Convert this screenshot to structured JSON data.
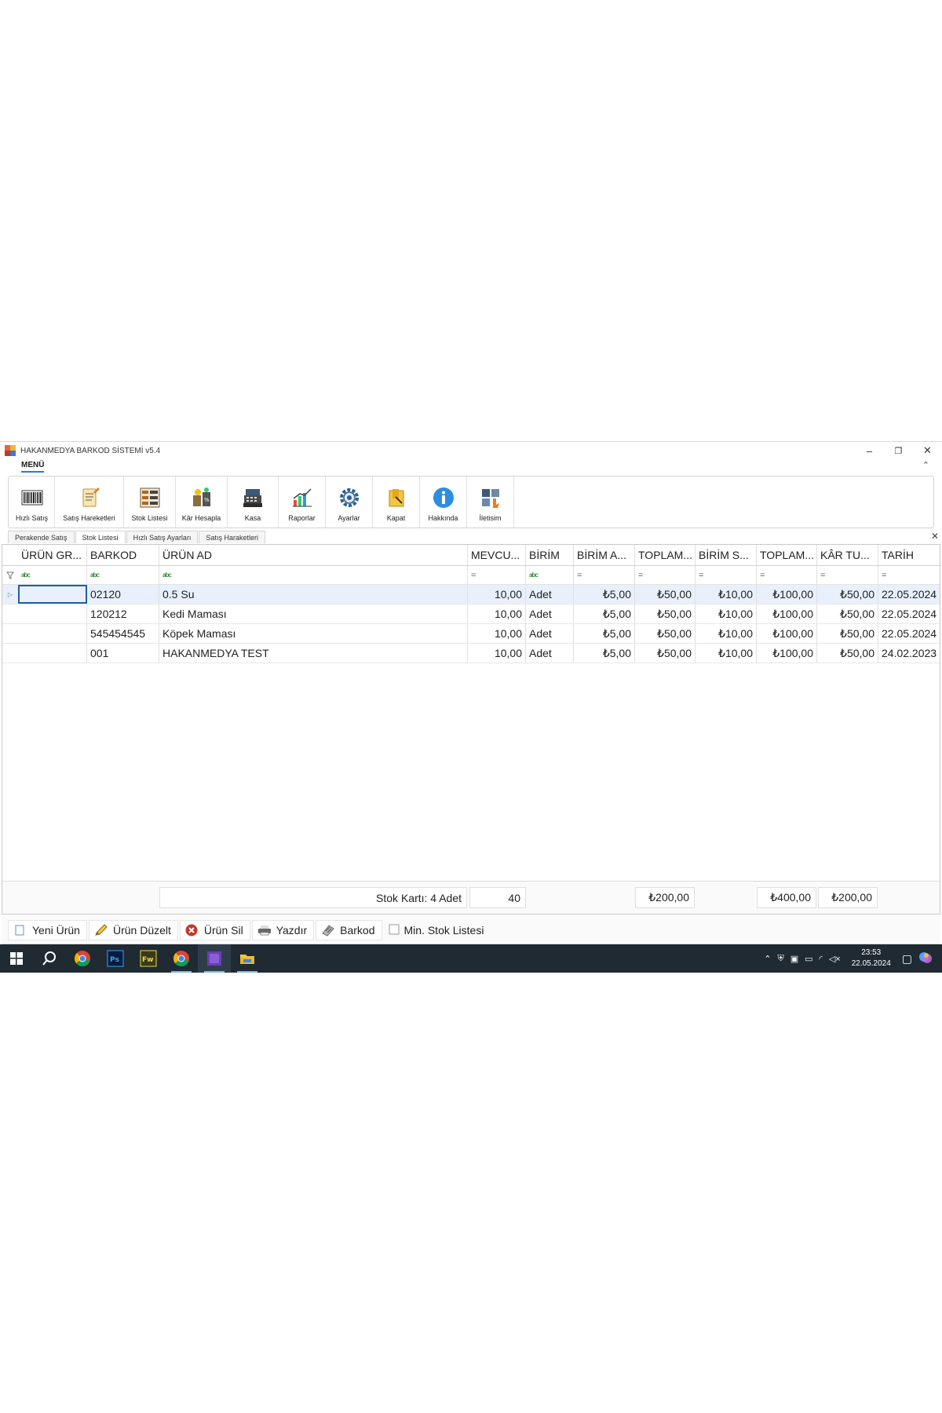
{
  "window": {
    "title": "HAKANMEDYA BARKOD SİSTEMİ v5.4",
    "minimize": "–",
    "restore": "❐",
    "close": "✕"
  },
  "menu": {
    "tab_label": "MENÜ",
    "collapse": "⌃"
  },
  "ribbon": {
    "buttons": [
      {
        "label": "Hızlı Satış",
        "icon": "barcode-icon"
      },
      {
        "label": "Satış Hareketleri",
        "icon": "notepad-icon"
      },
      {
        "label": "Stok Listesi",
        "icon": "stock-list-icon"
      },
      {
        "label": "Kâr Hesapla",
        "icon": "profit-calculator-icon"
      },
      {
        "label": "Kasa",
        "icon": "cash-register-icon"
      },
      {
        "label": "Raporlar",
        "icon": "chart-icon"
      },
      {
        "label": "Ayarlar",
        "icon": "gear-icon"
      },
      {
        "label": "Kapat",
        "icon": "exit-icon"
      },
      {
        "label": "Hakkında",
        "icon": "info-icon"
      },
      {
        "label": "İletisim",
        "icon": "contact-icon"
      }
    ]
  },
  "doc_tabs": [
    {
      "label": "Perakende Satış",
      "active": false
    },
    {
      "label": "Stok Listesi",
      "active": true
    },
    {
      "label": "Hızlı Satış Ayarları",
      "active": false
    },
    {
      "label": "Satış Haraketleri",
      "active": false
    }
  ],
  "doc_close": "✕",
  "grid": {
    "columns": [
      "ÜRÜN GR...",
      "BARKOD",
      "ÜRÜN AD",
      "MEVCU...",
      "BİRİM",
      "BİRİM A...",
      "TOPLAM...",
      "BİRİM S...",
      "TOPLAM...",
      "KÂR TU...",
      "TARİH"
    ],
    "filter_row": [
      "abc",
      "abc",
      "abc",
      "=",
      "abc",
      "=",
      "=",
      "=",
      "=",
      "=",
      "="
    ],
    "rows": [
      [
        "",
        "02120",
        "0.5 Su",
        "10,00",
        "Adet",
        "₺5,00",
        "₺50,00",
        "₺10,00",
        "₺100,00",
        "₺50,00",
        "22.05.2024"
      ],
      [
        "",
        "120212",
        "Kedi Maması",
        "10,00",
        "Adet",
        "₺5,00",
        "₺50,00",
        "₺10,00",
        "₺100,00",
        "₺50,00",
        "22.05.2024"
      ],
      [
        "",
        "545454545",
        "Köpek Maması",
        "10,00",
        "Adet",
        "₺5,00",
        "₺50,00",
        "₺10,00",
        "₺100,00",
        "₺50,00",
        "22.05.2024"
      ],
      [
        "",
        "001",
        "HAKANMEDYA TEST",
        "10,00",
        "Adet",
        "₺5,00",
        "₺50,00",
        "₺10,00",
        "₺100,00",
        "₺50,00",
        "24.02.2023"
      ]
    ],
    "totals": {
      "stok_karti": "Stok Kartı: 4 Adet",
      "mevcut": "40",
      "toplam_alis": "₺200,00",
      "toplam_satis": "₺400,00",
      "kar": "₺200,00"
    }
  },
  "bottom_toolbar": [
    {
      "label": "Yeni Ürün",
      "icon": "new-icon"
    },
    {
      "label": "Ürün Düzelt",
      "icon": "pencil-icon"
    },
    {
      "label": "Ürün Sil",
      "icon": "delete-icon"
    },
    {
      "label": "Yazdır",
      "icon": "printer-icon"
    },
    {
      "label": "Barkod",
      "icon": "barcode-label-icon"
    },
    {
      "label": "Min. Stok Listesi",
      "icon": "checkbox-icon"
    }
  ],
  "taskbar": {
    "clock_time": "23:53",
    "clock_date": "22.05.2024"
  },
  "colors": {
    "accent": "#2a7bd4",
    "selected_row": "#e8f1fb",
    "taskbar": "#1f2a33"
  }
}
